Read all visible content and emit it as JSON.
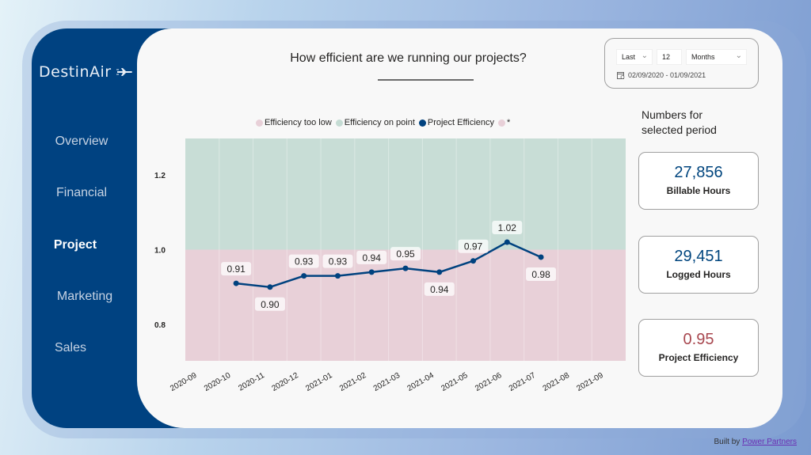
{
  "app": {
    "logo_text": "DestinAir",
    "logo_icon": "airplane-icon"
  },
  "sidebar": {
    "items": [
      {
        "label": "Overview",
        "active": false
      },
      {
        "label": "Financial",
        "active": false
      },
      {
        "label": "Project",
        "active": true
      },
      {
        "label": "Marketing",
        "active": false
      },
      {
        "label": "Sales",
        "active": false
      }
    ]
  },
  "header": {
    "title": "How efficient are we running our projects?"
  },
  "filter": {
    "mode": "Last",
    "count": "12",
    "unit": "Months",
    "date_range": "02/09/2020 - 01/09/2021",
    "calendar_icon": "calendar-icon"
  },
  "legend": [
    {
      "label": "Efficiency too low",
      "color": "#e8d0d8"
    },
    {
      "label": "Efficiency on point",
      "color": "#c5dcd4"
    },
    {
      "label": "Project Efficiency",
      "color": "#00427f"
    },
    {
      "label": "*",
      "color": "#e8d0d8"
    }
  ],
  "kpi": {
    "header_line1": "Numbers for",
    "header_line2": "selected period",
    "cards": [
      {
        "value": "27,856",
        "label": "Billable Hours",
        "color": "#00457e"
      },
      {
        "value": "29,451",
        "label": "Logged Hours",
        "color": "#00457e"
      },
      {
        "value": "0.95",
        "label": "Project Efficiency",
        "color": "#a8474f"
      }
    ]
  },
  "footer": {
    "prefix": "Built by ",
    "link": "Power Partners"
  },
  "chart_data": {
    "type": "line",
    "title": "",
    "xlabel": "",
    "ylabel": "",
    "categories": [
      "2020-09",
      "2020-10",
      "2020-11",
      "2020-12",
      "2021-01",
      "2021-02",
      "2021-03",
      "2021-04",
      "2021-05",
      "2021-06",
      "2021-07",
      "2021-08",
      "2021-09"
    ],
    "series": [
      {
        "name": "Project Efficiency",
        "color": "#00427f",
        "values": [
          null,
          0.91,
          0.9,
          0.93,
          0.93,
          0.94,
          0.95,
          0.94,
          0.97,
          1.02,
          0.98,
          null,
          null
        ]
      }
    ],
    "bands": [
      {
        "name": "Efficiency too low",
        "from": 0.7,
        "to": 1.0,
        "color": "#e8d0d8"
      },
      {
        "name": "Efficiency on point",
        "from": 1.0,
        "to": 1.3,
        "color": "#c8ddd6"
      }
    ],
    "yticks": [
      "0.8",
      "1.0",
      "1.2"
    ],
    "ytick_values": [
      0.8,
      1.0,
      1.2
    ],
    "ylim": [
      0.703,
      1.297
    ],
    "label_positions": [
      "",
      "above",
      "below",
      "above",
      "above",
      "above",
      "above",
      "below",
      "above",
      "above",
      "below",
      "",
      ""
    ],
    "legend_position": "top",
    "grid": false
  }
}
